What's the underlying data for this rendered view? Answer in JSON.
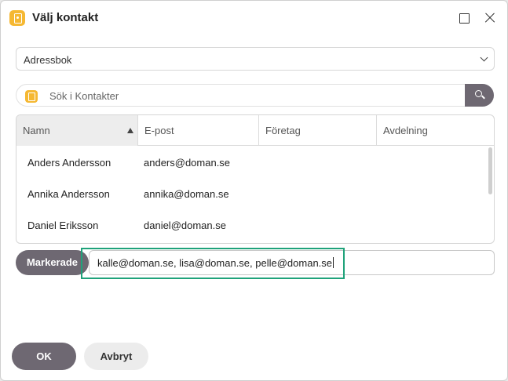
{
  "window": {
    "title": "Välj kontakt",
    "icon": "address-book-icon"
  },
  "addressbook": {
    "selected": "Adressbok"
  },
  "search": {
    "placeholder": "Sök i Kontakter"
  },
  "table": {
    "columns": [
      {
        "label": "Namn",
        "sorted": "ascending"
      },
      {
        "label": "E-post"
      },
      {
        "label": "Företag"
      },
      {
        "label": "Avdelning"
      }
    ],
    "rows": [
      {
        "name": "Anders Andersson",
        "email": "anders@doman.se",
        "company": "",
        "department": ""
      },
      {
        "name": "Annika Andersson",
        "email": "annika@doman.se",
        "company": "",
        "department": ""
      },
      {
        "name": "Daniel Eriksson",
        "email": "daniel@doman.se",
        "company": "",
        "department": ""
      }
    ]
  },
  "selected": {
    "button_label": "Markerade",
    "value": "kalle@doman.se, lisa@doman.se, pelle@doman.se"
  },
  "footer": {
    "ok_label": "OK",
    "cancel_label": "Avbryt"
  },
  "colors": {
    "accent": "#6e6872",
    "icon_yellow": "#f5b833",
    "highlight": "#1fa27a"
  }
}
